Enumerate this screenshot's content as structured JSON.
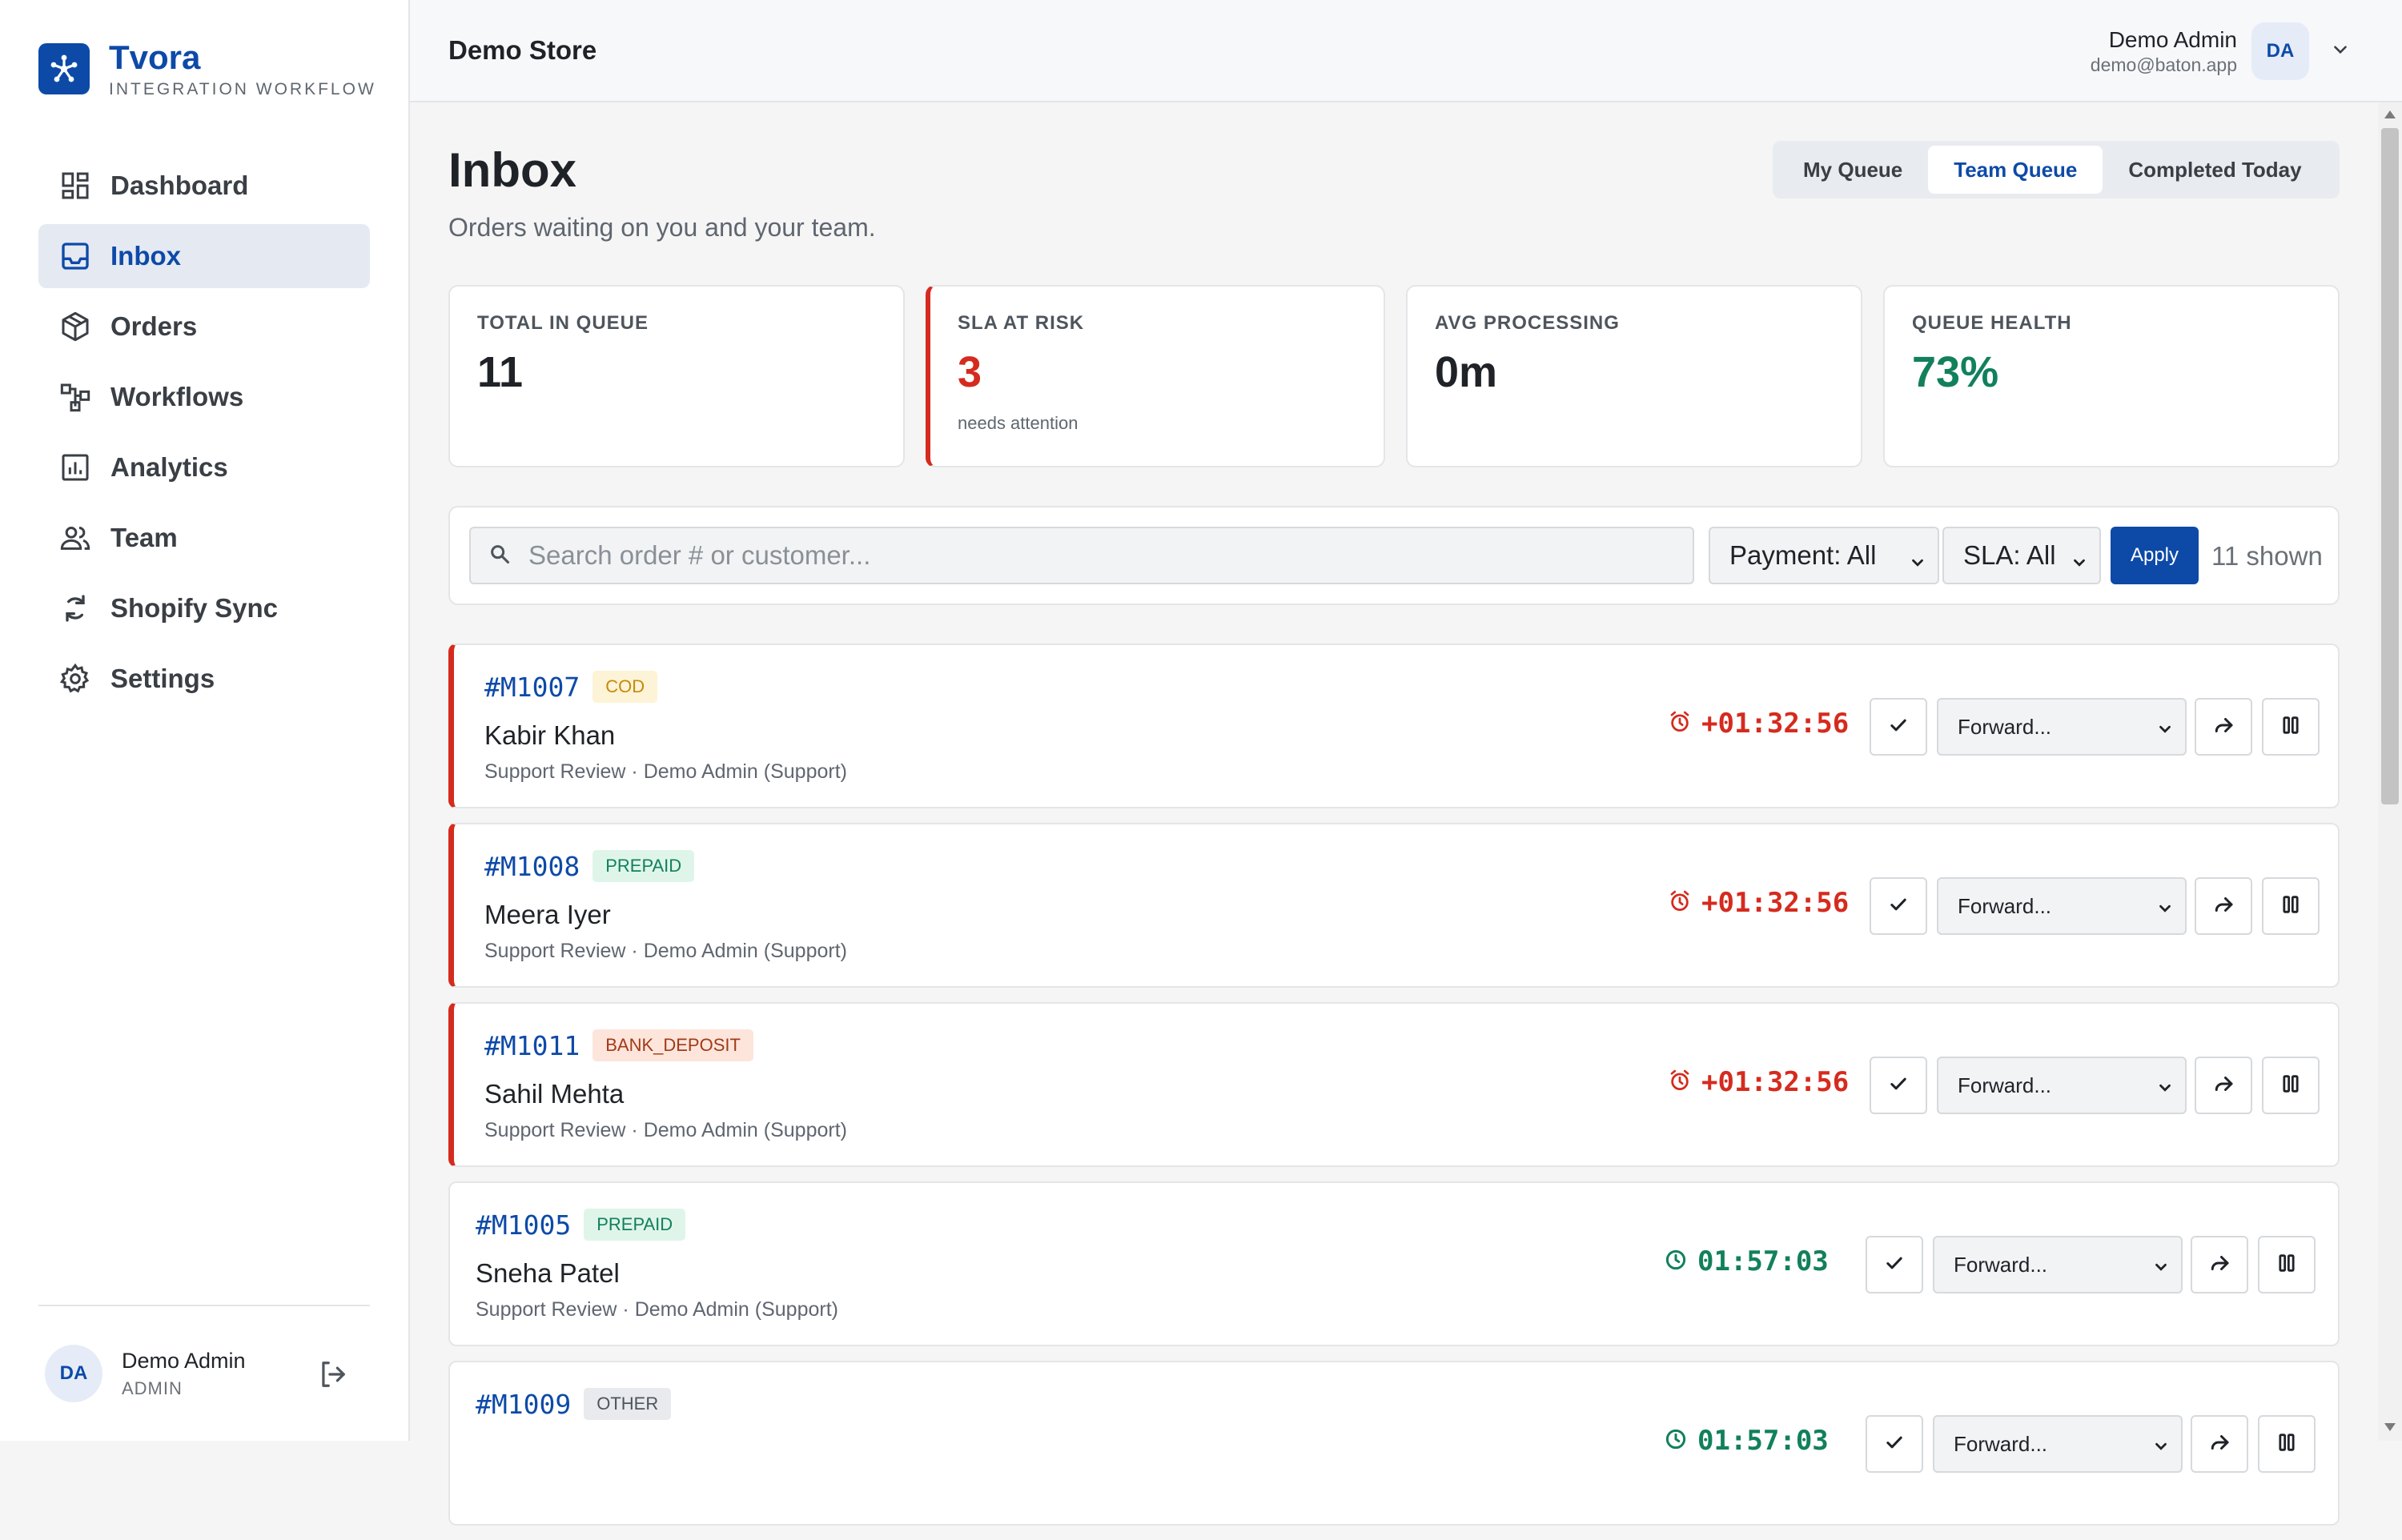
{
  "brand": {
    "name": "Tvora",
    "subtitle": "INTEGRATION WORKFLOW"
  },
  "sidebar": {
    "items": [
      {
        "label": "Dashboard",
        "icon": "dashboard-icon",
        "active": false
      },
      {
        "label": "Inbox",
        "icon": "inbox-icon",
        "active": true
      },
      {
        "label": "Orders",
        "icon": "package-icon",
        "active": false
      },
      {
        "label": "Workflows",
        "icon": "workflow-icon",
        "active": false
      },
      {
        "label": "Analytics",
        "icon": "analytics-icon",
        "active": false
      },
      {
        "label": "Team",
        "icon": "team-icon",
        "active": false
      },
      {
        "label": "Shopify Sync",
        "icon": "sync-icon",
        "active": false
      },
      {
        "label": "Settings",
        "icon": "gear-icon",
        "active": false
      }
    ],
    "footer": {
      "initials": "DA",
      "name": "Demo Admin",
      "role": "ADMIN"
    }
  },
  "header": {
    "store": "Demo Store",
    "user": {
      "name": "Demo Admin",
      "email": "demo@baton.app",
      "initials": "DA"
    }
  },
  "page": {
    "title": "Inbox",
    "subtitle": "Orders waiting on you and your team.",
    "tabs": [
      {
        "label": "My Queue",
        "active": false
      },
      {
        "label": "Team Queue",
        "active": true
      },
      {
        "label": "Completed Today",
        "active": false
      }
    ]
  },
  "stats": [
    {
      "label": "TOTAL IN QUEUE",
      "value": "11",
      "note": ""
    },
    {
      "label": "SLA AT RISK",
      "value": "3",
      "note": "needs attention"
    },
    {
      "label": "AVG PROCESSING",
      "value": "0m",
      "note": ""
    },
    {
      "label": "QUEUE HEALTH",
      "value": "73%",
      "note": ""
    }
  ],
  "filters": {
    "search_placeholder": "Search order # or customer...",
    "payment": "Payment: All",
    "sla": "SLA: All",
    "apply_label": "Apply",
    "shown": "11 shown"
  },
  "orders": [
    {
      "id": "#M1007",
      "payment": "COD",
      "customer": "Kabir Khan",
      "meta": "Support Review · Demo Admin (Support)",
      "timer": "+01:32:56",
      "overdue": true,
      "forward": "Forward..."
    },
    {
      "id": "#M1008",
      "payment": "PREPAID",
      "customer": "Meera Iyer",
      "meta": "Support Review · Demo Admin (Support)",
      "timer": "+01:32:56",
      "overdue": true,
      "forward": "Forward..."
    },
    {
      "id": "#M1011",
      "payment": "BANK_DEPOSIT",
      "customer": "Sahil Mehta",
      "meta": "Support Review · Demo Admin (Support)",
      "timer": "+01:32:56",
      "overdue": true,
      "forward": "Forward..."
    },
    {
      "id": "#M1005",
      "payment": "PREPAID",
      "customer": "Sneha Patel",
      "meta": "Support Review · Demo Admin (Support)",
      "timer": "01:57:03",
      "overdue": false,
      "forward": "Forward..."
    },
    {
      "id": "#M1009",
      "payment": "OTHER",
      "customer": "",
      "meta": "",
      "timer": "01:57:03",
      "overdue": false,
      "forward": "Forward..."
    }
  ],
  "colors": {
    "primary": "#0d4aa8",
    "danger": "#d52b1e",
    "success": "#12805c"
  }
}
